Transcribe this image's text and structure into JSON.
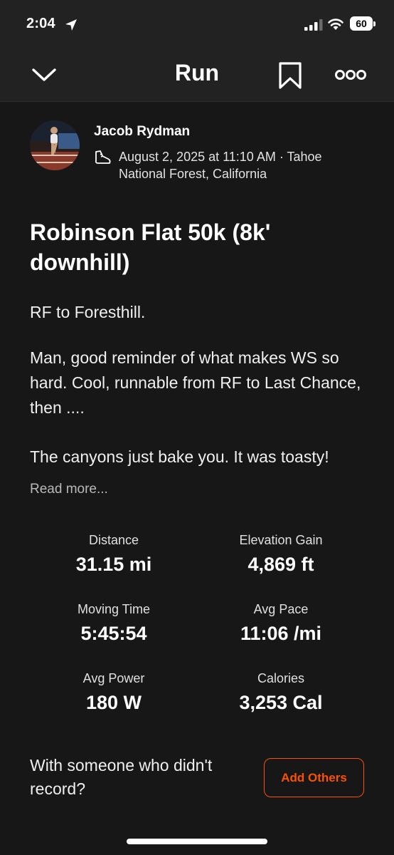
{
  "status_bar": {
    "time": "2:04",
    "battery": "60"
  },
  "nav": {
    "title": "Run"
  },
  "activity": {
    "athlete": "Jacob Rydman",
    "meta": "August 2, 2025 at 11:10 AM · Tahoe National Forest, California",
    "title": "Robinson Flat 50k (8k' downhill)",
    "description": [
      "RF to Foresthill.",
      "Man, good reminder of what makes WS so hard. Cool, runnable from RF to Last Chance, then ....",
      "The canyons just bake you. It was toasty!"
    ],
    "read_more": "Read more..."
  },
  "stats": [
    {
      "label": "Distance",
      "value": "31.15 mi"
    },
    {
      "label": "Elevation Gain",
      "value": "4,869 ft"
    },
    {
      "label": "Moving Time",
      "value": "5:45:54"
    },
    {
      "label": "Avg Pace",
      "value": "11:06 /mi"
    },
    {
      "label": "Avg Power",
      "value": "180 W"
    },
    {
      "label": "Calories",
      "value": "3,253 Cal"
    }
  ],
  "with_others": {
    "text": "With someone who didn't record?",
    "button": "Add Others"
  },
  "colors": {
    "accent": "#fc5200",
    "background": "#171717",
    "header": "#222222"
  },
  "icons": [
    "location-arrow-icon",
    "signal-icon",
    "wifi-icon",
    "battery-icon",
    "chevron-down-icon",
    "bookmark-icon",
    "more-icon",
    "shoe-icon"
  ]
}
